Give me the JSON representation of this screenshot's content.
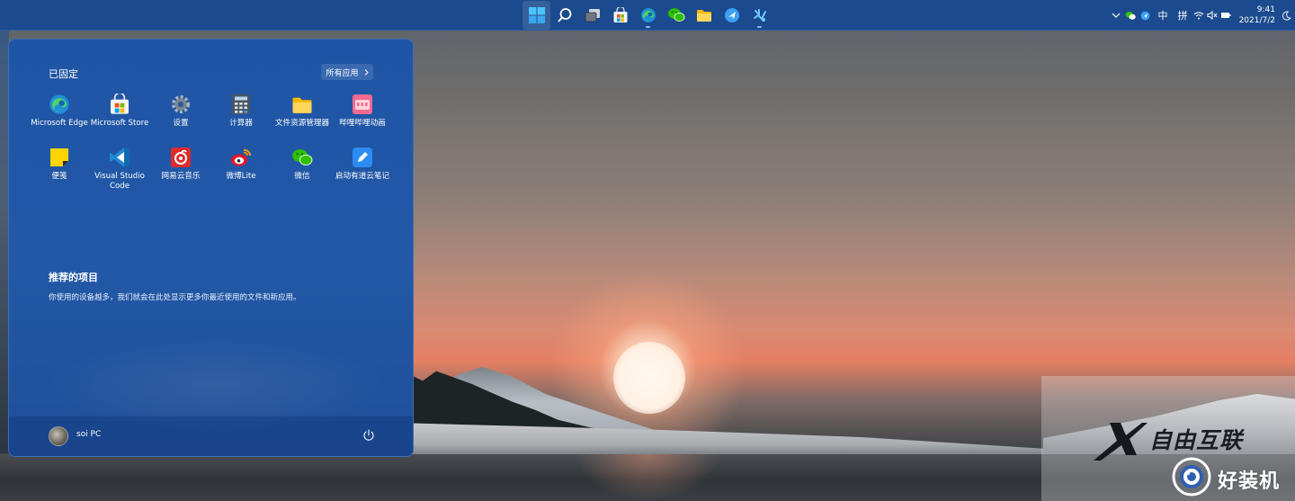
{
  "taskbar": {
    "apps": [
      {
        "name": "start",
        "icon": "windows-icon",
        "active": true
      },
      {
        "name": "search",
        "icon": "search-icon"
      },
      {
        "name": "task-view",
        "icon": "task-view-icon"
      },
      {
        "name": "microsoft-store",
        "icon": "store-icon"
      },
      {
        "name": "edge",
        "icon": "edge-icon",
        "running": true
      },
      {
        "name": "wechat",
        "icon": "wechat-icon"
      },
      {
        "name": "file-explorer",
        "icon": "folder-icon"
      },
      {
        "name": "feishu",
        "icon": "feishu-icon"
      },
      {
        "name": "youdao",
        "icon": "youdao-icon",
        "running": true
      }
    ],
    "tray": {
      "input_lang": "中",
      "ime": "拼",
      "time": "9:41",
      "date": "2021/7/2"
    }
  },
  "start_menu": {
    "pinned_title": "已固定",
    "all_apps_label": "所有应用",
    "pinned": [
      {
        "label": "Microsoft Edge",
        "icon": "edge-icon"
      },
      {
        "label": "Microsoft Store",
        "icon": "store-icon"
      },
      {
        "label": "设置",
        "icon": "settings-icon"
      },
      {
        "label": "计算器",
        "icon": "calculator-icon"
      },
      {
        "label": "文件资源管理器",
        "icon": "folder-icon"
      },
      {
        "label": "哔哩哔哩动画",
        "icon": "bilibili-icon"
      },
      {
        "label": "便笺",
        "icon": "sticky-notes-icon"
      },
      {
        "label": "Visual Studio Code",
        "icon": "vscode-icon"
      },
      {
        "label": "网易云音乐",
        "icon": "netease-music-icon"
      },
      {
        "label": "微博Lite",
        "icon": "weibo-icon"
      },
      {
        "label": "微信",
        "icon": "wechat-icon"
      },
      {
        "label": "启动有道云笔记",
        "icon": "youdao-note-icon"
      }
    ],
    "recommended_title": "推荐的项目",
    "recommended_desc": "你使用的设备越多，我们就会在此处显示更多你最近使用的文件和新应用。",
    "user_name": "soi PC"
  },
  "watermark": {
    "line1": "自由互联",
    "line2": "好装机"
  },
  "colors": {
    "taskbar": "#1b4a8e",
    "start_menu": "#2258a6"
  }
}
